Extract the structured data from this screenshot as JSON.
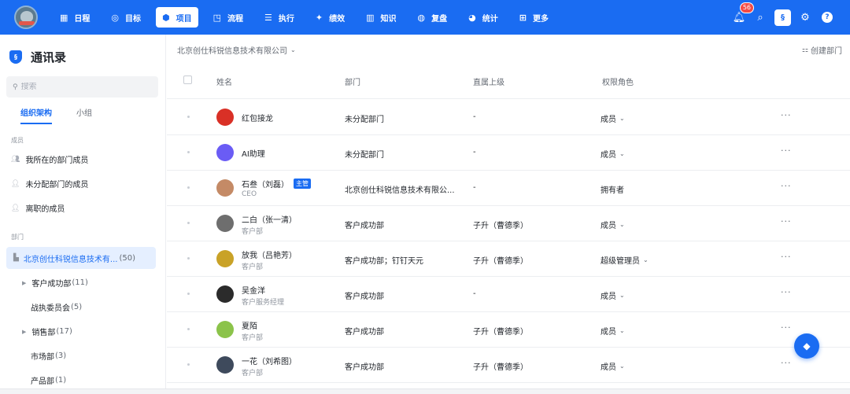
{
  "nav": {
    "items": [
      {
        "label": "日程",
        "icon": "calendar-icon",
        "glyph": "▦"
      },
      {
        "label": "目标",
        "icon": "target-icon",
        "glyph": "◎"
      },
      {
        "label": "项目",
        "icon": "cube-icon",
        "glyph": "⬢"
      },
      {
        "label": "流程",
        "icon": "flow-icon",
        "glyph": "◳"
      },
      {
        "label": "执行",
        "icon": "list-icon",
        "glyph": "☰"
      },
      {
        "label": "绩效",
        "icon": "star-icon",
        "glyph": "✦"
      },
      {
        "label": "知识",
        "icon": "book-icon",
        "glyph": "▥"
      },
      {
        "label": "复盘",
        "icon": "review-icon",
        "glyph": "◍"
      },
      {
        "label": "统计",
        "icon": "pie-chart-icon",
        "glyph": "◕"
      },
      {
        "label": "更多",
        "icon": "grid-icon",
        "glyph": "⊞"
      }
    ],
    "active_index": 2,
    "notification_count": "56",
    "workspace_glyph": "§",
    "help_glyph": "?"
  },
  "sidebar": {
    "title": "通讯录",
    "title_glyph": "§",
    "search_placeholder": "搜索",
    "tabs": [
      "组织架构",
      "小组"
    ],
    "members_section": "成员",
    "member_items": [
      "我所在的部门成员",
      "未分配部门的成员",
      "离职的成员"
    ],
    "dept_section": "部门",
    "selected_dept": {
      "name": "北京创仕科锐信息技术有...",
      "count": "(50)"
    },
    "departments": [
      {
        "name": "客户成功部",
        "count": "(11)",
        "expandable": true
      },
      {
        "name": "战执委员会",
        "count": "(5)",
        "expandable": false
      },
      {
        "name": "销售部",
        "count": "(17)",
        "expandable": true
      },
      {
        "name": "市场部",
        "count": "(3)",
        "expandable": false
      },
      {
        "name": "产品部",
        "count": "(1)",
        "expandable": false
      }
    ]
  },
  "main": {
    "company_selector": "北京创仕科锐信息技术有限公司",
    "create_dept_label": "创建部门",
    "columns": [
      "姓名",
      "部门",
      "直属上级",
      "权限角色"
    ],
    "rows": [
      {
        "name": "红包接龙",
        "title": "",
        "tag": "",
        "dept": "未分配部门",
        "manager": "-",
        "role": "成员",
        "role_dropdown": true,
        "avatar_color": "#d93026"
      },
      {
        "name": "AI助理",
        "title": "",
        "tag": "",
        "dept": "未分配部门",
        "manager": "-",
        "role": "成员",
        "role_dropdown": true,
        "avatar_color": "#6a5cf5"
      },
      {
        "name": "石叁（刘磊）",
        "title": "CEO",
        "tag": "主管",
        "dept": "北京创仕科锐信息技术有限公...",
        "manager": "-",
        "role": "拥有者",
        "role_dropdown": false,
        "avatar_color": "#c48a66"
      },
      {
        "name": "二白（张一清）",
        "title": "客户部",
        "tag": "",
        "dept": "客户成功部",
        "manager": "子升（曹德季）",
        "role": "成员",
        "role_dropdown": true,
        "avatar_color": "#6e6e6e"
      },
      {
        "name": "放我（吕艳芳）",
        "title": "客户部",
        "tag": "",
        "dept": "客户成功部；钉钉天元",
        "manager": "子升（曹德季）",
        "role": "超级管理员",
        "role_dropdown": true,
        "avatar_color": "#c9a227"
      },
      {
        "name": "吴金洋",
        "title": "客户服务经理",
        "tag": "",
        "dept": "客户成功部",
        "manager": "-",
        "role": "成员",
        "role_dropdown": true,
        "avatar_color": "#2b2b2b"
      },
      {
        "name": "夏陌",
        "title": "客户部",
        "tag": "",
        "dept": "客户成功部",
        "manager": "子升（曹德季）",
        "role": "成员",
        "role_dropdown": true,
        "avatar_color": "#8bc34a"
      },
      {
        "name": "一花（刘希图）",
        "title": "客户部",
        "tag": "",
        "dept": "客户成功部",
        "manager": "子升（曹德季）",
        "role": "成员",
        "role_dropdown": true,
        "avatar_color": "#3e4a5c"
      }
    ]
  },
  "colors": {
    "brand": "#1a6cf2",
    "selected_bg": "#e5efff",
    "badge": "#f54a45"
  }
}
